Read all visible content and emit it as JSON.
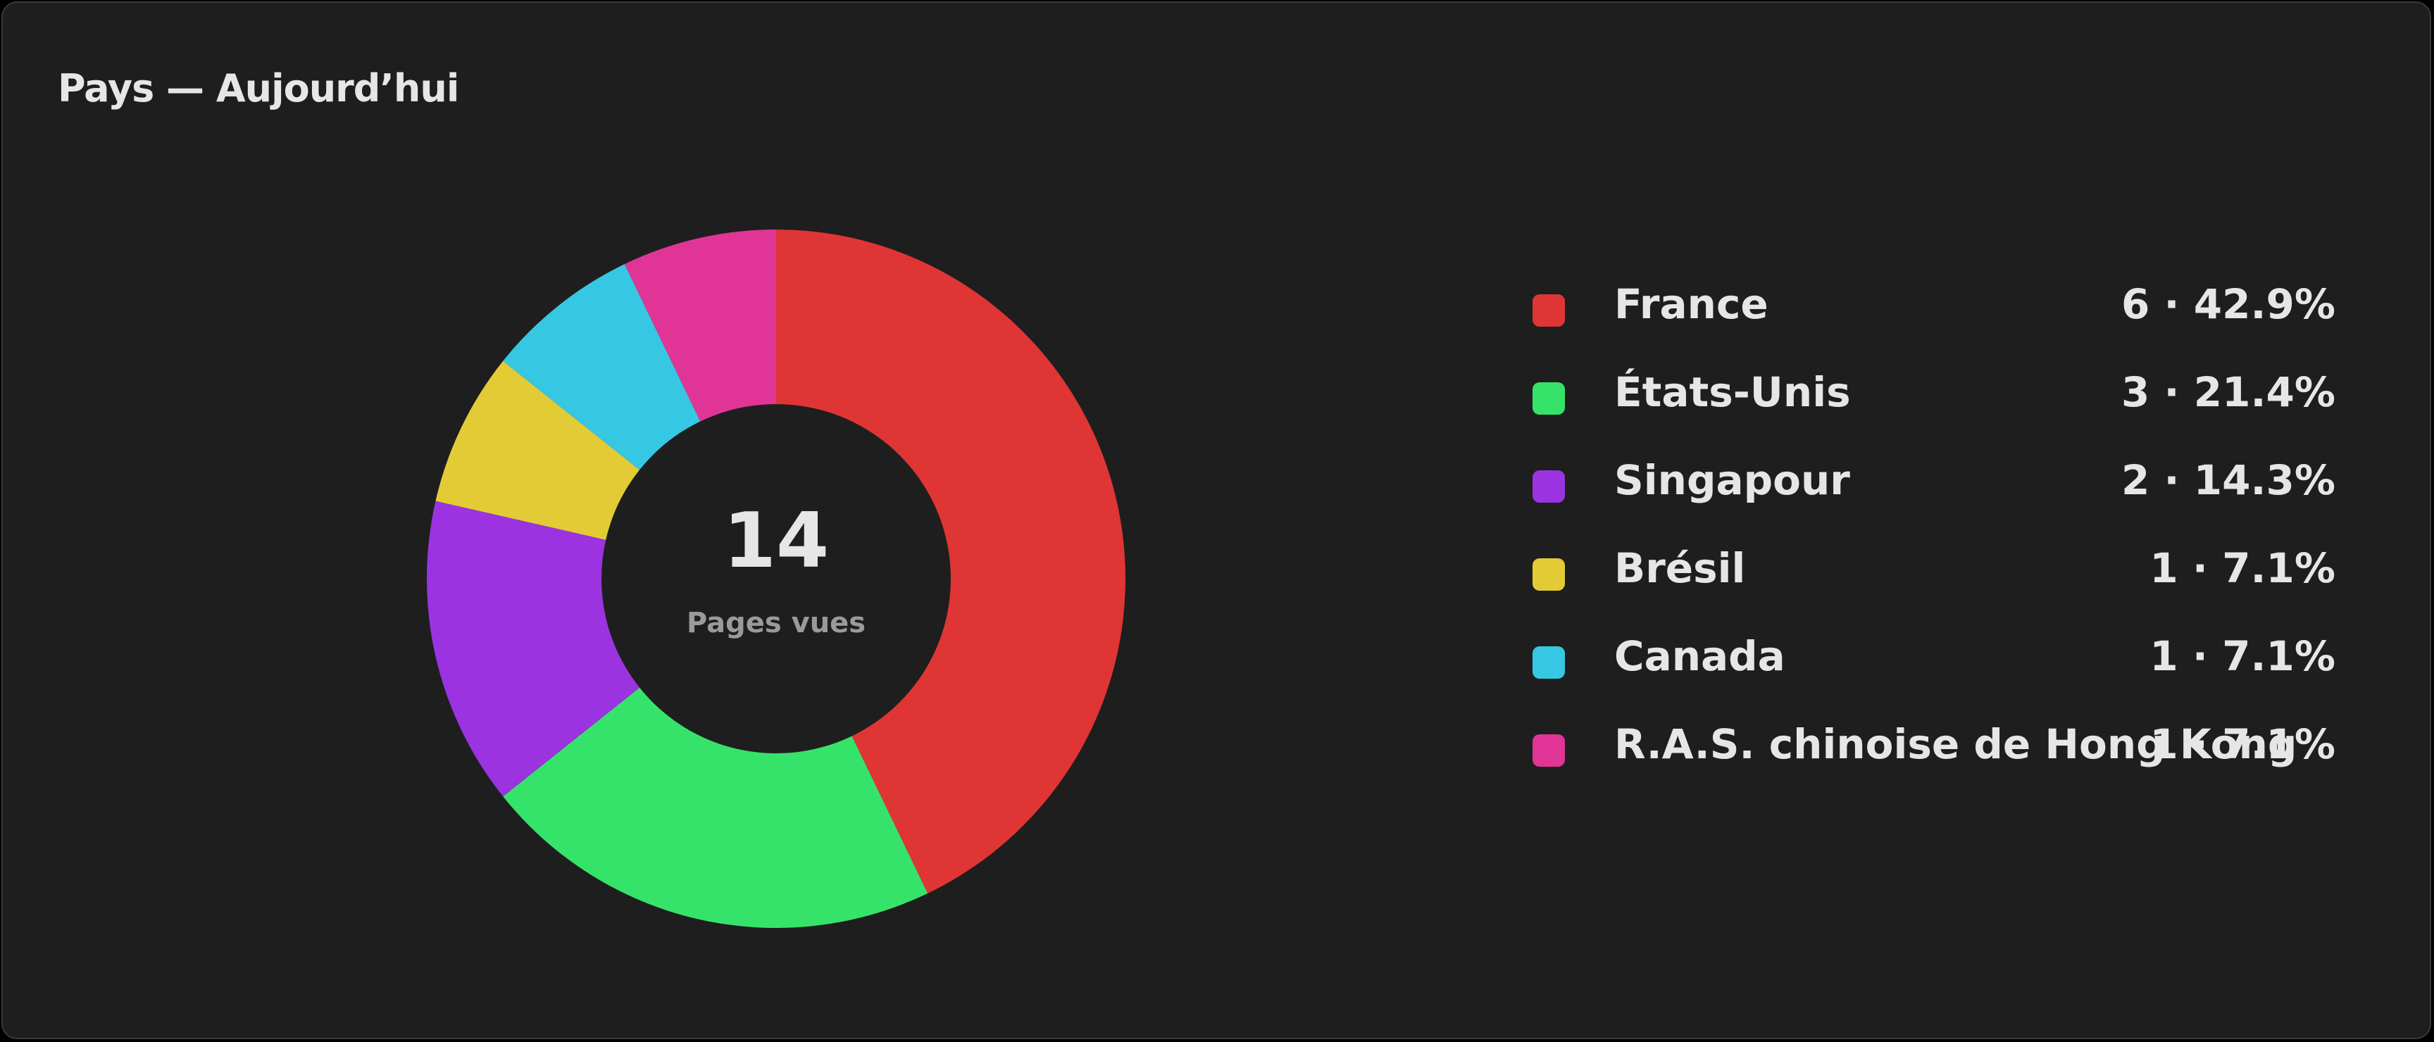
{
  "card": {
    "title": "Pays — Aujourd’hui"
  },
  "center": {
    "total": "14",
    "caption": "Pages vues"
  },
  "colors": {
    "background": "#1e1e1e",
    "text": "#e6e6e6",
    "muted": "#9a9a9a"
  },
  "chart_data": {
    "type": "pie",
    "variant": "donut",
    "title": "Pays — Aujourd’hui",
    "center_value": 14,
    "center_label": "Pages vues",
    "legend_position": "right",
    "slices": [
      {
        "label": "France",
        "value": 6,
        "percent": 42.9,
        "display": "6 · 42.9%",
        "color": "#e03535"
      },
      {
        "label": "États-Unis",
        "value": 3,
        "percent": 21.4,
        "display": "3 · 21.4%",
        "color": "#36e36a"
      },
      {
        "label": "Singapour",
        "value": 2,
        "percent": 14.3,
        "display": "2 · 14.3%",
        "color": "#9b33e0"
      },
      {
        "label": "Brésil",
        "value": 1,
        "percent": 7.1,
        "display": "1 · 7.1%",
        "color": "#e3cb36"
      },
      {
        "label": "Canada",
        "value": 1,
        "percent": 7.1,
        "display": "1 · 7.1%",
        "color": "#36c7e3"
      },
      {
        "label": "R.A.S. chinoise de Hong Kong",
        "value": 1,
        "percent": 7.1,
        "display": "1 · 7.1%",
        "color": "#e03596"
      }
    ]
  }
}
